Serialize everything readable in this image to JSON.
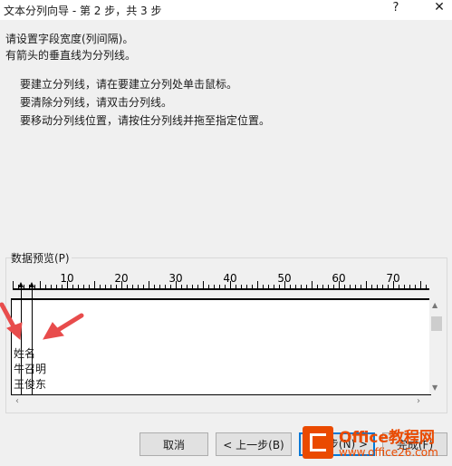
{
  "window": {
    "title": "文本分列向导 - 第 2 步，共 3 步",
    "help_label": "?",
    "close_label": "✕"
  },
  "instructions": {
    "line1": "请设置字段宽度(列间隔)。",
    "line2": "有箭头的垂直线为分列线。",
    "tip1": "要建立分列线，请在要建立分列处单击鼠标。",
    "tip2": "要清除分列线，请双击分列线。",
    "tip3": "要移动分列线位置，请按住分列线并拖至指定位置。"
  },
  "preview": {
    "group_label": "数据预览(P)",
    "ruler_numbers": [
      "10",
      "20",
      "30",
      "40",
      "50",
      "60",
      "70"
    ],
    "rows": [
      "姓名",
      "牛召明",
      "王俊东"
    ]
  },
  "buttons": {
    "cancel": "取消",
    "back": "< 上一步(B)",
    "next": "下一步(N) >",
    "finish": "完成(F)"
  },
  "watermark": {
    "name": "Office教程网",
    "site": "www.office26.com"
  },
  "colors": {
    "annotation_arrow": "#e84c4c",
    "primary_button_border": "#0078d7",
    "watermark_brand": "#ea4a00"
  },
  "icons": {
    "help": "question-mark-icon",
    "close": "close-icon",
    "annotation": "red-arrow-icon"
  }
}
